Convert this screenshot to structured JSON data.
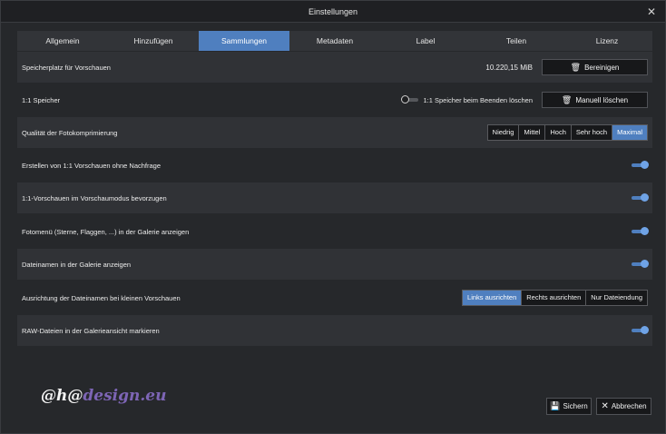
{
  "window": {
    "title": "Einstellungen",
    "close_glyph": "✕"
  },
  "tabs": [
    {
      "label": "Allgemein",
      "active": false
    },
    {
      "label": "Hinzufügen",
      "active": false
    },
    {
      "label": "Sammlungen",
      "active": true
    },
    {
      "label": "Metadaten",
      "active": false
    },
    {
      "label": "Label",
      "active": false
    },
    {
      "label": "Teilen",
      "active": false
    },
    {
      "label": "Lizenz",
      "active": false
    }
  ],
  "settings": {
    "preview_storage": {
      "label": "Speicherplatz für Vorschauen",
      "value": "10.220,15 MiB",
      "button": "Bereinigen"
    },
    "one_to_one": {
      "label": "1:1 Speicher",
      "toggle_label": "1:1 Speicher beim Beenden löschen",
      "toggle_on": false,
      "button": "Manuell löschen"
    },
    "compression": {
      "label": "Qualität der Fotokomprimierung",
      "options": [
        "Niedrig",
        "Mittel",
        "Hoch",
        "Sehr hoch",
        "Maximal"
      ],
      "selected": "Maximal"
    },
    "create_previews": {
      "label": "Erstellen von 1:1 Vorschauen ohne Nachfrage",
      "toggle_on": true
    },
    "prefer_previews": {
      "label": "1:1-Vorschauen im Vorschaumodus bevorzugen",
      "toggle_on": true
    },
    "photo_menu": {
      "label": "Fotomenü (Sterne, Flaggen, ...) in der Galerie anzeigen",
      "toggle_on": true
    },
    "file_names": {
      "label": "Dateinamen in der Galerie anzeigen",
      "toggle_on": true
    },
    "alignment": {
      "label": "Ausrichtung der Dateinamen bei kleinen Vorschauen",
      "options": [
        "Links ausrichten",
        "Rechts ausrichten",
        "Nur Dateiendung"
      ],
      "selected": "Links ausrichten"
    },
    "raw_mark": {
      "label": "RAW-Dateien in der Galerieansicht markieren",
      "toggle_on": true
    }
  },
  "footer": {
    "save_label": "Sichern",
    "cancel_label": "Abbrechen"
  },
  "watermark": {
    "part1": "@h@",
    "part2": "design.eu"
  },
  "colors": {
    "accent": "#4f7fbf",
    "background": "#26282b",
    "row_alt": "#303236"
  }
}
